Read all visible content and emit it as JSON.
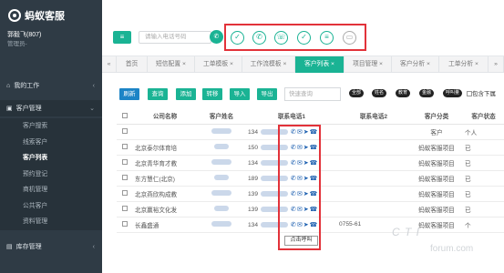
{
  "sidebar": {
    "logo_text": "蚂蚁客服",
    "user_name": "郭毅飞(807)",
    "user_role": "管理员-",
    "nav": {
      "work": "我的工作",
      "customers": "客户管理",
      "inventory": "库存管理"
    },
    "sub_items": [
      "客户搜索",
      "线索客户",
      "客户列表",
      "预约登记",
      "商机管理",
      "公共客户",
      "资料管理"
    ],
    "active_sub": 2
  },
  "topbar": {
    "phone_placeholder": "请输入电话号码",
    "call_icons": [
      "check-circle-icon",
      "phone-icon",
      "phone-transfer-icon",
      "check-icon",
      "notes-icon",
      "voicemail-icon"
    ]
  },
  "tabs": [
    "首页",
    "短信配置 ×",
    "工单模板 ×",
    "工作流模板 ×",
    "客户列表 ×",
    "项目管理 ×",
    "客户分析 ×",
    "工单分析 ×"
  ],
  "active_tab": 4,
  "toolbar": {
    "buttons": [
      "刷新",
      "查询",
      "添加",
      "转移",
      "导入",
      "导出"
    ],
    "search_placeholder": "快速查询",
    "filters": [
      "全部",
      "姓名",
      "教育",
      "金融",
      "呼叫量"
    ],
    "include_label": "包含下属"
  },
  "table": {
    "headers": [
      "",
      "公司名称",
      "客户姓名",
      "联系电话1",
      "联系电话2",
      "客户分类",
      "客户状态"
    ],
    "rows": [
      {
        "company": "",
        "phone1": "134",
        "phone2": "",
        "category": "客户",
        "status": "个人"
      },
      {
        "company": "北京泰尔体育培",
        "phone1": "150",
        "phone2": "",
        "category": "蚂蚁客服项目",
        "status": "已"
      },
      {
        "company": "北京青华育才教",
        "phone1": "134",
        "phone2": "",
        "category": "蚂蚁客服项目",
        "status": "已"
      },
      {
        "company": "东方慧仁(北京)",
        "phone1": "189",
        "phone2": "",
        "category": "蚂蚁客服项目",
        "status": "已"
      },
      {
        "company": "北京燕欣构成教",
        "phone1": "139",
        "phone2": "",
        "category": "蚂蚁客服项目",
        "status": "已"
      },
      {
        "company": "北京赢裕文化发",
        "phone1": "139",
        "phone2": "",
        "category": "蚂蚁客服项目",
        "status": "已"
      },
      {
        "company": "长鑫盛通",
        "phone1": "134",
        "phone2": "0755-61",
        "category": "蚂蚁客服项目",
        "status": "个"
      }
    ]
  },
  "tooltip": "点击呼叫",
  "watermark": {
    "line1": "C T I",
    "line2": "forum.com"
  },
  "colors": {
    "accent": "#1ab394",
    "highlight": "#e2323a",
    "sidebar": "#2f3b45",
    "link": "#1c84c6"
  }
}
